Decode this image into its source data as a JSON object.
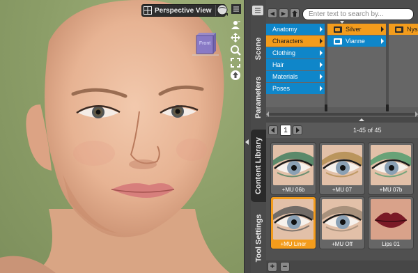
{
  "viewport": {
    "camera_label": "Perspective View",
    "nav_cube_label": "Front",
    "tools": [
      "figure-select-icon",
      "pan-icon",
      "zoom-icon",
      "frame-icon",
      "reset-icon"
    ]
  },
  "side_tabs": [
    {
      "label": "Scene",
      "active": false
    },
    {
      "label": "Parameters",
      "active": false
    },
    {
      "label": "Content Library",
      "active": true
    },
    {
      "label": "Tool Settings",
      "active": false
    }
  ],
  "search": {
    "placeholder": "Enter text to search by..."
  },
  "categories": {
    "col1": [
      {
        "label": "Anatomy",
        "selected": false
      },
      {
        "label": "Characters",
        "selected": true
      },
      {
        "label": "Clothing",
        "selected": false
      },
      {
        "label": "Hair",
        "selected": false
      },
      {
        "label": "Materials",
        "selected": false
      },
      {
        "label": "Poses",
        "selected": false
      }
    ],
    "col2": [
      {
        "label": "Silver",
        "selected": true
      },
      {
        "label": "Vianne",
        "selected": false
      }
    ],
    "col3": [
      {
        "label": "Nyss",
        "selected": true
      }
    ]
  },
  "pager": {
    "page": "1",
    "results": "1-45 of 45"
  },
  "grid": {
    "items": [
      {
        "label": "+MU 06b",
        "selected": false,
        "kind": "eye",
        "shadow": "#3a7a5a"
      },
      {
        "label": "+MU 07",
        "selected": false,
        "kind": "eye",
        "shadow": "#b08a4a"
      },
      {
        "label": "+MU 07b",
        "selected": false,
        "kind": "eye",
        "shadow": "#4a9a6a"
      },
      {
        "label": "+MU Liner",
        "selected": true,
        "kind": "eye",
        "shadow": "#555555"
      },
      {
        "label": "+MU Off",
        "selected": false,
        "kind": "eye",
        "shadow": "#9a8470"
      },
      {
        "label": "Lips 01",
        "selected": false,
        "kind": "lips",
        "shadow": "#7a1a26"
      }
    ]
  },
  "colors": {
    "viewport_bg": "#8ea06a",
    "accent_blue": "#0f86c9",
    "accent_orange": "#f39c1c",
    "panel_bg": "#5a5a5a"
  }
}
